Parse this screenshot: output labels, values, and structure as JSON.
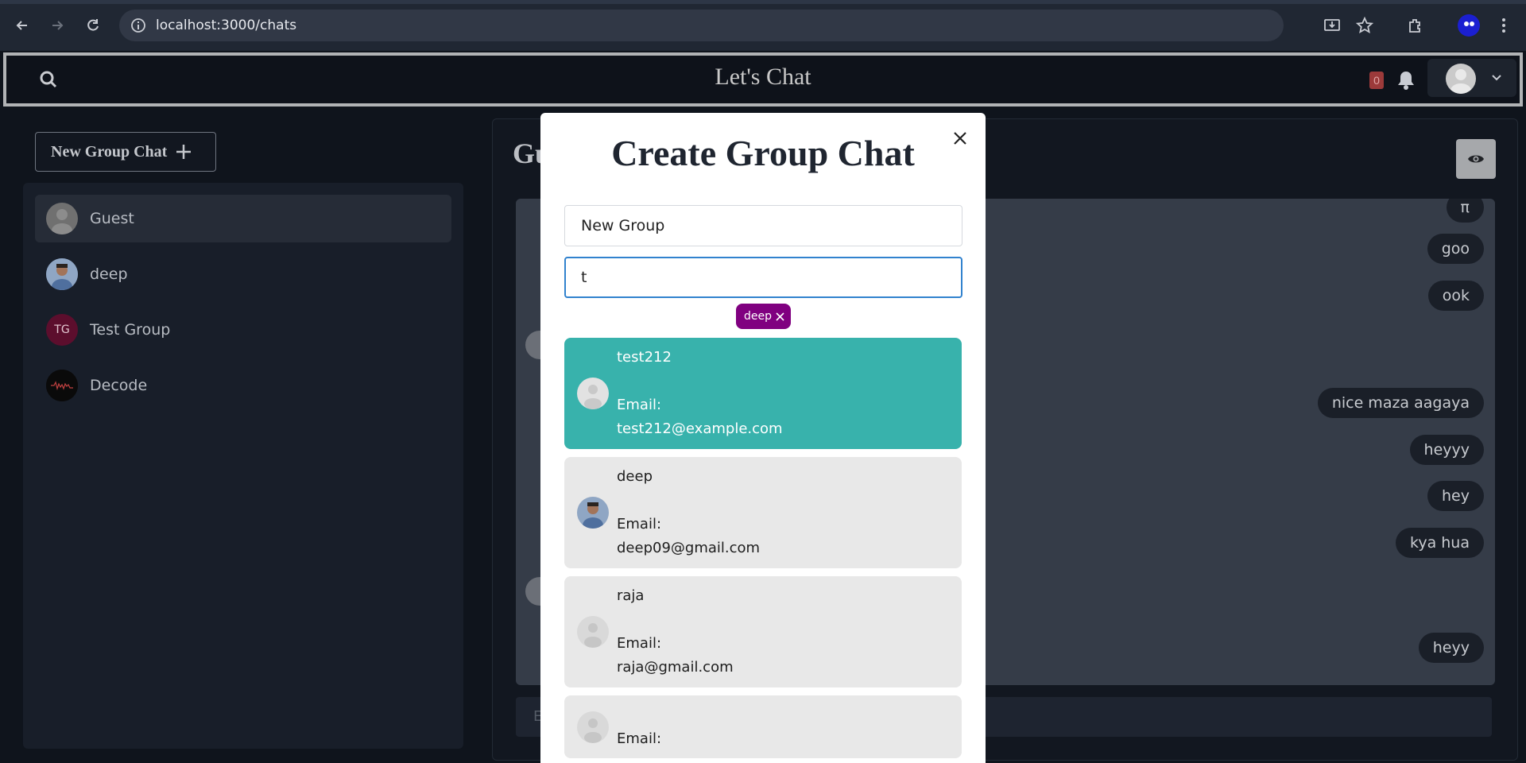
{
  "browser": {
    "url": "localhost:3000/chats"
  },
  "header": {
    "title": "Let's Chat",
    "notification_count": "0"
  },
  "sidebar": {
    "new_group_label": "New Group Chat",
    "chats": [
      {
        "name": "Guest",
        "avatar": "default-avatar",
        "active": true
      },
      {
        "name": "deep",
        "avatar": "photo-avatar",
        "active": false
      },
      {
        "name": "Test Group",
        "avatar_initials": "TG",
        "active": false
      },
      {
        "name": "Decode",
        "avatar": "photo-avatar",
        "active": false
      }
    ]
  },
  "chat": {
    "title": "Gu",
    "input_placeholder": "E",
    "messages": [
      "π",
      "goo",
      "ook",
      "nice maza aagaya",
      "heyyy",
      "hey",
      "kya hua",
      "heyy"
    ]
  },
  "modal": {
    "title": "Create Group Chat",
    "chat_name_value": "New Group",
    "search_value": "t",
    "selected_tags": [
      "deep"
    ],
    "users": [
      {
        "name": "test212",
        "email_label": "Email:",
        "email": "test212@example.com",
        "selected": true
      },
      {
        "name": "deep",
        "email_label": "Email:",
        "email": "deep09@gmail.com",
        "selected": false
      },
      {
        "name": "raja",
        "email_label": "Email:",
        "email": "raja@gmail.com",
        "selected": false
      },
      {
        "name": "",
        "email_label": "Email:",
        "email": "",
        "selected": false
      }
    ]
  },
  "colors": {
    "selected_user": "#38b2ac",
    "tag": "#800080",
    "focus_border": "#3182ce"
  }
}
